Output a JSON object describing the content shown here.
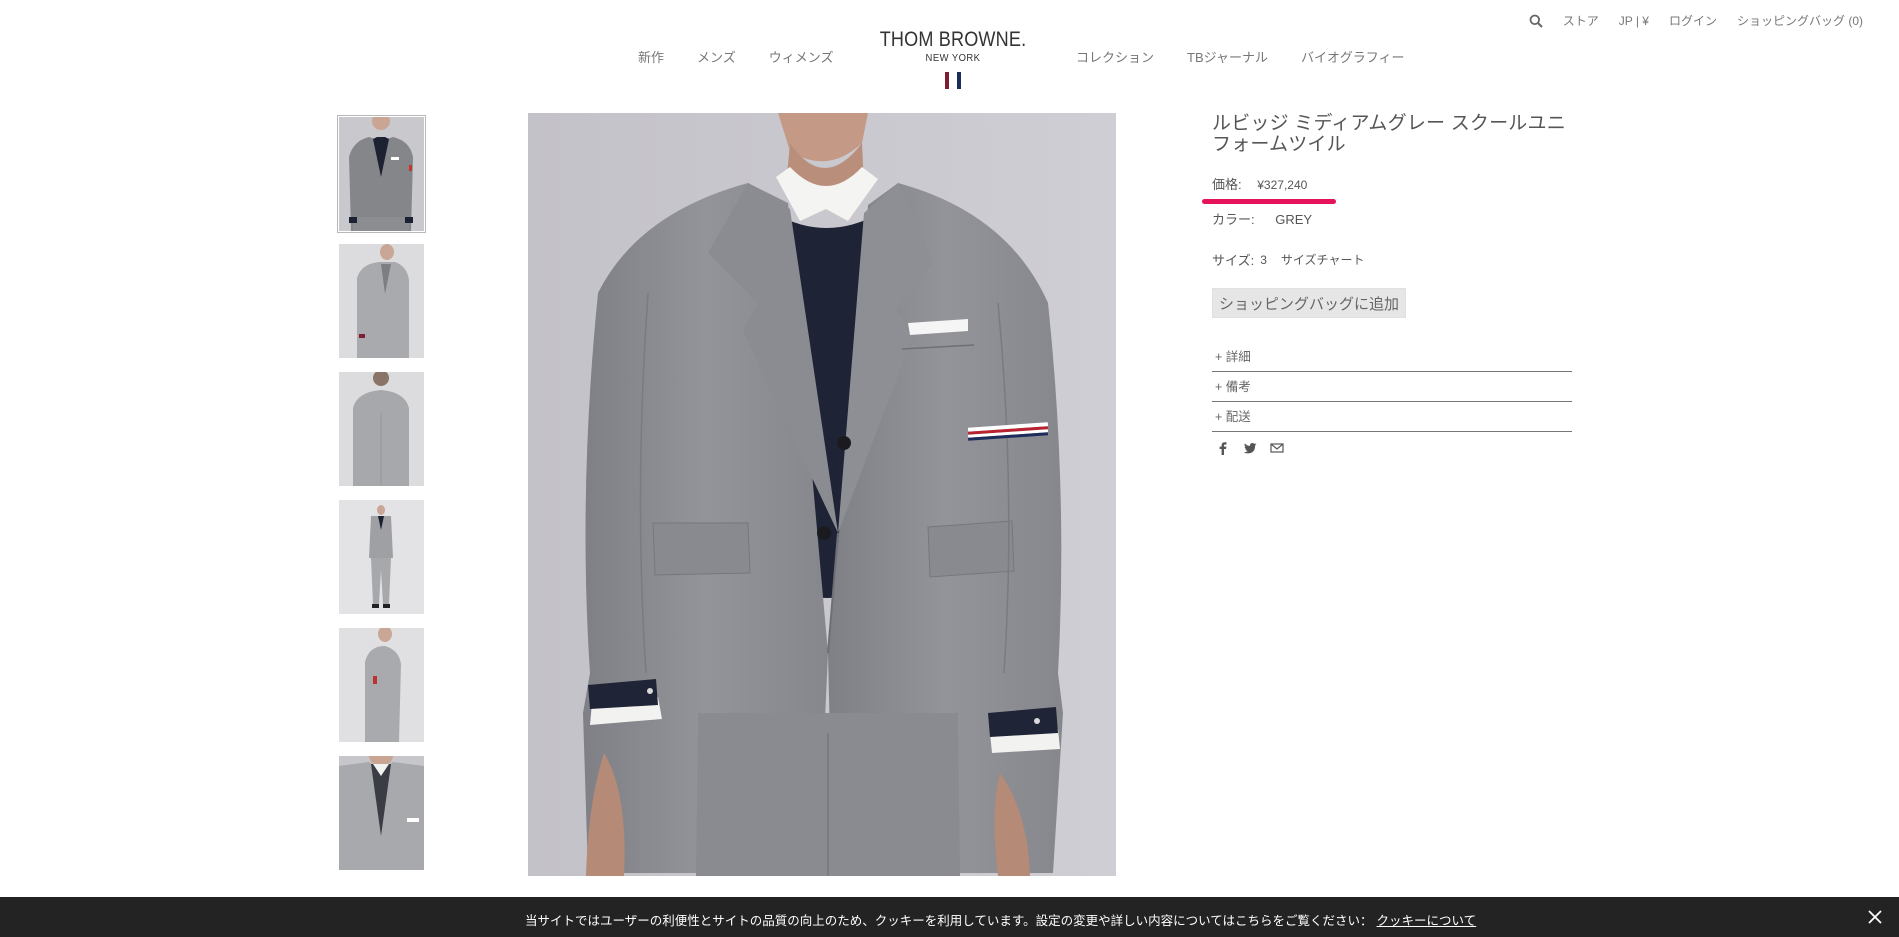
{
  "utility": {
    "store": "ストア",
    "locale": "JP | ¥",
    "login": "ログイン",
    "bag": "ショッピングバッグ (0)"
  },
  "nav": {
    "left": [
      "新作",
      "メンズ",
      "ウィメンズ"
    ],
    "right": [
      "コレクション",
      "TBジャーナル",
      "バイオグラフィー"
    ]
  },
  "logo": {
    "main": "THOM BROWNE.",
    "sub": "NEW YORK"
  },
  "product": {
    "title": "ルビッジ ミディアムグレー スクールユニフォームツイル",
    "price_label": "価格:",
    "price": "¥327,240",
    "color_label": "カラー:",
    "color": "GREY",
    "size_label": "サイズ:",
    "size": "3",
    "size_chart": "サイズチャート",
    "add_to_bag": "ショッピングバッグに追加"
  },
  "accordion": [
    "+ 詳細",
    "+ 備考",
    "+ 配送"
  ],
  "cookie": {
    "text": "当サイトではユーザーの利便性とサイトの品質の向上のため、クッキーを利用しています。設定の変更や詳しい内容についてはこちらをご覧ください：",
    "link": "クッキーについて"
  },
  "colors": {
    "highlight": "#e5135c",
    "suit_grey": "#8d8e92",
    "navy": "#1f2436",
    "cookie_bg": "#232323"
  }
}
